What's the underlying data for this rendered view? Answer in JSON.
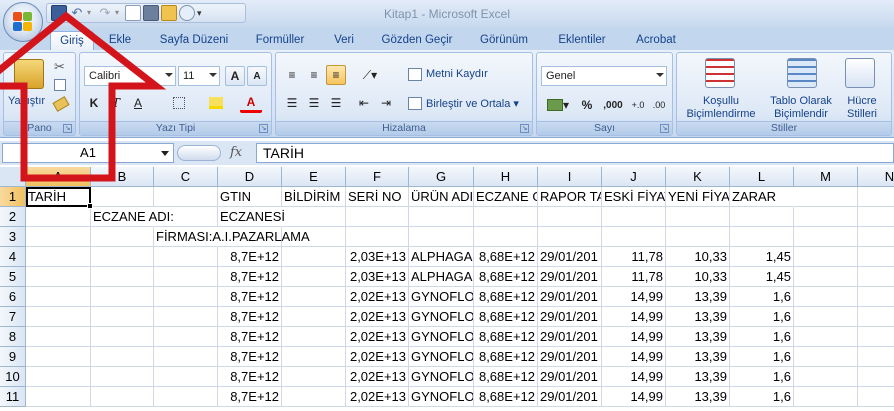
{
  "window": {
    "title": "Kitap1 - Microsoft Excel"
  },
  "tabs": [
    {
      "label": "Giriş",
      "active": true
    },
    {
      "label": "Ekle"
    },
    {
      "label": "Sayfa Düzeni"
    },
    {
      "label": "Formüller"
    },
    {
      "label": "Veri"
    },
    {
      "label": "Gözden Geçir"
    },
    {
      "label": "Görünüm"
    },
    {
      "label": "Eklentiler"
    },
    {
      "label": "Acrobat"
    }
  ],
  "ribbon": {
    "clipboard": {
      "label": "Pano",
      "paste": "Yapıştır"
    },
    "font": {
      "label": "Yazı Tipi",
      "name": "Calibri",
      "size": "11"
    },
    "alignment": {
      "label": "Hizalama",
      "wrap": "Metni Kaydır",
      "merge": "Birleştir ve Ortala"
    },
    "number": {
      "label": "Sayı",
      "format": "Genel",
      "percent": "%",
      "thousands": ",000"
    },
    "styles": {
      "label": "Stiller",
      "conditional": "Koşullu Biçimlendirme",
      "table": "Tablo Olarak Biçimlendir",
      "cell": "Hücre Stilleri"
    }
  },
  "formula_bar": {
    "name_box": "A1",
    "fx": "fx",
    "value": "TARİH"
  },
  "columns": [
    "A",
    "B",
    "C",
    "D",
    "E",
    "F",
    "G",
    "H",
    "I",
    "J",
    "K",
    "L",
    "M",
    "N"
  ],
  "rows": [
    [
      "TARİH",
      "",
      "",
      "GTIN",
      "BİLDİRİM I",
      "SERİ NO",
      "ÜRÜN ADI",
      "ECZANE G",
      "RAPOR TA",
      "ESKİ FİYAT",
      "YENİ FİYAT",
      "ZARAR",
      "",
      ""
    ],
    [
      "",
      "ECZANE ADI:",
      "",
      "ECZANESİ",
      "",
      "",
      "",
      "",
      "",
      "",
      "",
      "",
      "",
      ""
    ],
    [
      "",
      "",
      "FİRMASI:A.I.PAZARLAMA",
      "",
      "",
      "",
      "",
      "",
      "",
      "",
      "",
      "",
      "",
      ""
    ],
    [
      "",
      "",
      "",
      "8,7E+12",
      "",
      "2,03E+13",
      "ALPHAGAI",
      "8,68E+12",
      "29/01/201",
      "11,78",
      "10,33",
      "1,45",
      "",
      ""
    ],
    [
      "",
      "",
      "",
      "8,7E+12",
      "",
      "2,03E+13",
      "ALPHAGAI",
      "8,68E+12",
      "29/01/201",
      "11,78",
      "10,33",
      "1,45",
      "",
      ""
    ],
    [
      "",
      "",
      "",
      "8,7E+12",
      "",
      "2,02E+13",
      "GYNOFLOI",
      "8,68E+12",
      "29/01/201",
      "14,99",
      "13,39",
      "1,6",
      "",
      ""
    ],
    [
      "",
      "",
      "",
      "8,7E+12",
      "",
      "2,02E+13",
      "GYNOFLOI",
      "8,68E+12",
      "29/01/201",
      "14,99",
      "13,39",
      "1,6",
      "",
      ""
    ],
    [
      "",
      "",
      "",
      "8,7E+12",
      "",
      "2,02E+13",
      "GYNOFLOI",
      "8,68E+12",
      "29/01/201",
      "14,99",
      "13,39",
      "1,6",
      "",
      ""
    ],
    [
      "",
      "",
      "",
      "8,7E+12",
      "",
      "2,02E+13",
      "GYNOFLOI",
      "8,68E+12",
      "29/01/201",
      "14,99",
      "13,39",
      "1,6",
      "",
      ""
    ],
    [
      "",
      "",
      "",
      "8,7E+12",
      "",
      "2,02E+13",
      "GYNOFLOI",
      "8,68E+12",
      "29/01/201",
      "14,99",
      "13,39",
      "1,6",
      "",
      ""
    ],
    [
      "",
      "",
      "",
      "8,7E+12",
      "",
      "2,02E+13",
      "GYNOFLOI",
      "8,68E+12",
      "29/01/201",
      "14,99",
      "13,39",
      "1,6",
      "",
      ""
    ]
  ],
  "row_numbers": [
    "1",
    "2",
    "3",
    "4",
    "5",
    "6",
    "7",
    "8",
    "9",
    "10",
    "11"
  ],
  "accent": {
    "annotation_arrow": "#d4141b",
    "selection": "#f1c15f"
  }
}
